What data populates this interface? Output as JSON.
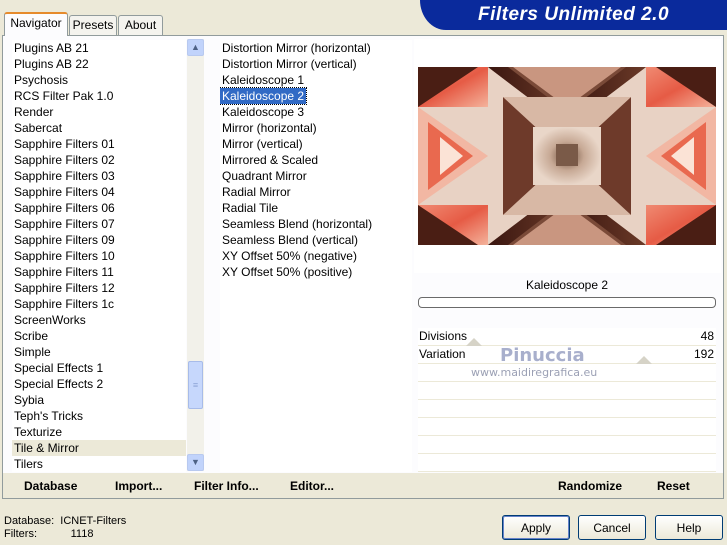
{
  "app": {
    "title": "Filters Unlimited 2.0"
  },
  "tabs": [
    {
      "label": "Navigator",
      "active": true
    },
    {
      "label": "Presets",
      "active": false
    },
    {
      "label": "About",
      "active": false
    }
  ],
  "categories": [
    "Plugins AB 21",
    "Plugins AB 22",
    "Psychosis",
    "RCS Filter Pak 1.0",
    "Render",
    "Sabercat",
    "Sapphire Filters 01",
    "Sapphire Filters 02",
    "Sapphire Filters 03",
    "Sapphire Filters 04",
    "Sapphire Filters 06",
    "Sapphire Filters 07",
    "Sapphire Filters 09",
    "Sapphire Filters 10",
    "Sapphire Filters 11",
    "Sapphire Filters 12",
    "Sapphire Filters 1c",
    "ScreenWorks",
    "Scribe",
    "Simple",
    "Special Effects 1",
    "Special Effects 2",
    "Sybia",
    "Teph's Tricks",
    "Texturize",
    "Tile & Mirror",
    "Tilers"
  ],
  "selected_category": "Tile & Mirror",
  "filters": [
    "Distortion Mirror (horizontal)",
    "Distortion Mirror (vertical)",
    "Kaleidoscope 1",
    "Kaleidoscope 2",
    "Kaleidoscope 3",
    "Mirror (horizontal)",
    "Mirror (vertical)",
    "Mirrored & Scaled",
    "Quadrant Mirror",
    "Radial Mirror",
    "Radial Tile",
    "Seamless Blend (horizontal)",
    "Seamless Blend (vertical)",
    "XY Offset 50% (negative)",
    "XY Offset 50% (positive)"
  ],
  "selected_filter": "Kaleidoscope 2",
  "preview": {
    "filter_name": "Kaleidoscope 2"
  },
  "parameters": [
    {
      "label": "Divisions",
      "value": "48"
    },
    {
      "label": "Variation",
      "value": "192"
    }
  ],
  "watermark": {
    "line1": "Pinuccia",
    "line2": "www.maidiregrafica.eu"
  },
  "action_bar": {
    "database": "Database",
    "import": "Import...",
    "filter_info": "Filter Info...",
    "editor": "Editor...",
    "randomize": "Randomize",
    "reset": "Reset"
  },
  "footer": {
    "database_label": "Database:",
    "database_value": "ICNET-Filters",
    "filters_label": "Filters:",
    "filters_value": "1118",
    "apply": "Apply",
    "cancel": "Cancel",
    "help": "Help"
  },
  "colors": {
    "banner": "#0a2a9c",
    "selection": "#316ac5",
    "window_bg": "#ece9d8"
  },
  "icons": {
    "scroll_up": "chevron-up-icon",
    "scroll_down": "chevron-down-icon",
    "scroll_grip": "grip-icon"
  }
}
